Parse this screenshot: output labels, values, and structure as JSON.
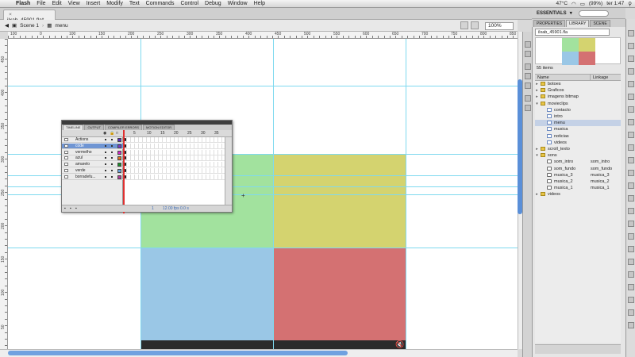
{
  "menubar": {
    "items": [
      "Flash",
      "File",
      "Edit",
      "View",
      "Insert",
      "Modify",
      "Text",
      "Commands",
      "Control",
      "Debug",
      "Window",
      "Help"
    ],
    "battery": "(99%)",
    "clock": "ter 1:47",
    "temp": "47°C",
    "cslive": "CS Live"
  },
  "document": {
    "tab_title": "ilxab_45901.fla*"
  },
  "editbar": {
    "scene": "Scene 1",
    "symbol": "menu",
    "zoom": "100%"
  },
  "ruler": {
    "h": [
      "100",
      "0",
      "100",
      "150",
      "200",
      "250",
      "300",
      "350",
      "400",
      "450",
      "500",
      "550",
      "600",
      "650",
      "700",
      "750",
      "800",
      "850"
    ],
    "v": [
      "450",
      "400",
      "350",
      "300",
      "250",
      "200",
      "150",
      "100",
      "50",
      "0"
    ]
  },
  "stage": {
    "colors": {
      "green": "#a2e29e",
      "yellow": "#d4d36f",
      "blue": "#9ac7e6",
      "red": "#d47172",
      "footer": "#2b2b2b",
      "guide": "#7fd9ef"
    },
    "speaker_icon": "speaker-muted-icon"
  },
  "right_panel": {
    "workspace": "ESSENTIALS",
    "tabs": [
      "PROPERTIES",
      "LIBRARY",
      "SCENE"
    ],
    "active_tab": "LIBRARY",
    "library_select": "ilxab_45901.fla",
    "item_count": "55 items",
    "col_name": "Name",
    "col_linkage": "Linkage",
    "items": [
      {
        "type": "folder",
        "name": "botoes",
        "level": 0,
        "open": false,
        "linkage": ""
      },
      {
        "type": "folder",
        "name": "Graficos",
        "level": 0,
        "open": false,
        "linkage": ""
      },
      {
        "type": "folder",
        "name": "imagens bitmap",
        "level": 0,
        "open": false,
        "linkage": ""
      },
      {
        "type": "folder",
        "name": "movieclips",
        "level": 0,
        "open": true,
        "linkage": ""
      },
      {
        "type": "mc",
        "name": "contacto",
        "level": 1,
        "linkage": ""
      },
      {
        "type": "mc",
        "name": "intro",
        "level": 1,
        "linkage": ""
      },
      {
        "type": "mc",
        "name": "menu",
        "level": 1,
        "linkage": "",
        "selected": true
      },
      {
        "type": "mc",
        "name": "musica",
        "level": 1,
        "linkage": ""
      },
      {
        "type": "mc",
        "name": "noticias",
        "level": 1,
        "linkage": ""
      },
      {
        "type": "mc",
        "name": "videos",
        "level": 1,
        "linkage": ""
      },
      {
        "type": "folder",
        "name": "scroll_texto",
        "level": 0,
        "open": false,
        "linkage": ""
      },
      {
        "type": "folder",
        "name": "sons",
        "level": 0,
        "open": true,
        "linkage": ""
      },
      {
        "type": "snd",
        "name": "som_intro",
        "level": 1,
        "linkage": "som_intro"
      },
      {
        "type": "snd",
        "name": "som_fundo",
        "level": 1,
        "linkage": "som_fundo"
      },
      {
        "type": "snd",
        "name": "musica_3",
        "level": 1,
        "linkage": "musica_3"
      },
      {
        "type": "snd",
        "name": "musica_2",
        "level": 1,
        "linkage": "musica_2"
      },
      {
        "type": "snd",
        "name": "musica_1",
        "level": 1,
        "linkage": "musica_1"
      },
      {
        "type": "folder",
        "name": "videos",
        "level": 0,
        "open": false,
        "linkage": ""
      }
    ]
  },
  "timeline": {
    "tabs": [
      "TIMELINE",
      "OUTPUT",
      "COMPILER ERRORS",
      "MOTION EDITOR"
    ],
    "active_tab": "TIMELINE",
    "frame_numbers": [
      "5",
      "10",
      "15",
      "20",
      "25",
      "30",
      "35"
    ],
    "layers": [
      {
        "name": "Actions",
        "color": "#5b2bc7",
        "selected": false
      },
      {
        "name": "code",
        "color": "#7a3acb",
        "selected": true
      },
      {
        "name": "vermelho",
        "color": "#d02cc8",
        "selected": false
      },
      {
        "name": "azul",
        "color": "#e07424",
        "selected": false
      },
      {
        "name": "amarelo",
        "color": "#1a8f2a",
        "selected": false
      },
      {
        "name": "verde",
        "color": "#6aa4e0",
        "selected": false
      },
      {
        "name": "borradefu...",
        "color": "#b03c9a",
        "selected": false
      }
    ],
    "frame": "1",
    "fps": "12.00 fps",
    "seconds": "0.0 s"
  }
}
